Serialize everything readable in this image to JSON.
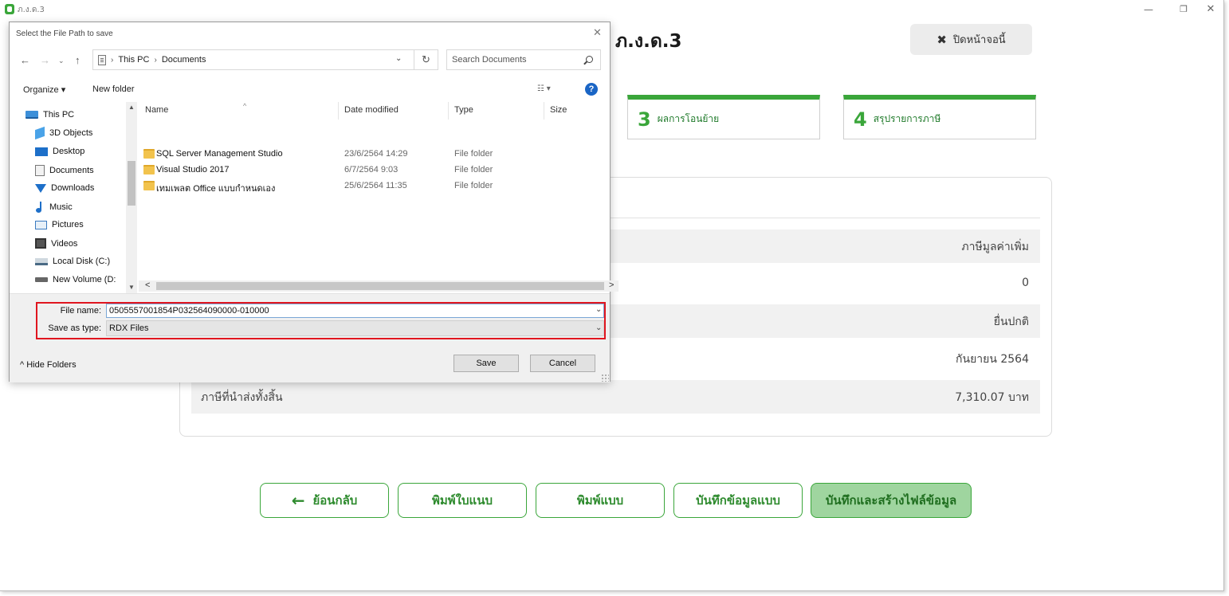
{
  "app": {
    "title": "ภ.ง.ด.3",
    "window_controls": {
      "minimize": "—",
      "maximize": "❐",
      "close": "✕"
    }
  },
  "main": {
    "form_title": "ภ.ง.ด.3",
    "close_screen_icon": "✖",
    "close_screen_label": "ปิดหน้าจอนี้",
    "steps": [
      {
        "number": "3",
        "label": "ผลการโอนย้าย"
      },
      {
        "number": "4",
        "label": "สรุปรายการภาษี"
      }
    ],
    "summary_rows": [
      {
        "label": "",
        "value": "ภาษีมูลค่าเพิ่ม"
      },
      {
        "label": "",
        "value": "0"
      },
      {
        "label": "",
        "value": "ยื่นปกติ"
      },
      {
        "label": "",
        "value": "กันยายน 2564"
      },
      {
        "label": "ภาษีที่นำส่งทั้งสิ้น",
        "value": "7,310.07 บาท"
      }
    ],
    "buttons": {
      "back_arrow": "←",
      "back": "ย้อนกลับ",
      "print_attachment": "พิมพ์ใบแนบ",
      "print_form": "พิมพ์แบบ",
      "save_form_data": "บันทึกข้อมูลแบบ",
      "save_and_create_file": "บันทึกและสร้างไฟล์ข้อมูล"
    }
  },
  "dialog": {
    "title": "Select the File Path to save",
    "close": "✕",
    "nav": {
      "back": "←",
      "forward": "→",
      "recent": "⌄",
      "up": "↑",
      "refresh": "↻",
      "dropdown": "⌄"
    },
    "breadcrumb": [
      "This PC",
      "Documents"
    ],
    "breadcrumb_sep": "›",
    "search_placeholder": "Search Documents",
    "organize_label": "Organize ▾",
    "new_folder_label": "New folder",
    "view_label": "☷ ▾",
    "help_label": "?",
    "nav_items": [
      {
        "label": "This PC",
        "icon": "pc-icon"
      },
      {
        "label": "3D Objects",
        "icon": "3d-objects-icon"
      },
      {
        "label": "Desktop",
        "icon": "desktop-icon"
      },
      {
        "label": "Documents",
        "icon": "documents-icon"
      },
      {
        "label": "Downloads",
        "icon": "downloads-icon"
      },
      {
        "label": "Music",
        "icon": "music-icon"
      },
      {
        "label": "Pictures",
        "icon": "pictures-icon"
      },
      {
        "label": "Videos",
        "icon": "videos-icon"
      },
      {
        "label": "Local Disk (C:)",
        "icon": "local-disk-icon"
      },
      {
        "label": "New Volume (D:",
        "icon": "volume-icon"
      }
    ],
    "columns": {
      "name": "Name",
      "date": "Date modified",
      "type": "Type",
      "size": "Size"
    },
    "sort_indicator": "^",
    "files": [
      {
        "name": "SQL Server Management Studio",
        "date": "23/6/2564 14:29",
        "type": "File folder"
      },
      {
        "name": "Visual Studio 2017",
        "date": "6/7/2564 9:03",
        "type": "File folder"
      },
      {
        "name": "เทมเพลต Office แบบกำหนดเอง",
        "date": "25/6/2564 11:35",
        "type": "File folder"
      }
    ],
    "scroll": {
      "up": "▲",
      "down": "▼",
      "left": "<",
      "right": ">"
    },
    "file_name_label": "File name:",
    "file_name_value": "0505557001854P032564090000-010000",
    "save_as_type_label": "Save as type:",
    "save_as_type_value": "RDX Files",
    "dropdown_glyph": "⌄",
    "hide_folders_label": "^  Hide Folders",
    "save_label": "Save",
    "cancel_label": "Cancel"
  },
  "colors": {
    "accent": "#3aa63a",
    "highlight": "#e0161f",
    "dialog_bg": "#f0f0f0"
  }
}
